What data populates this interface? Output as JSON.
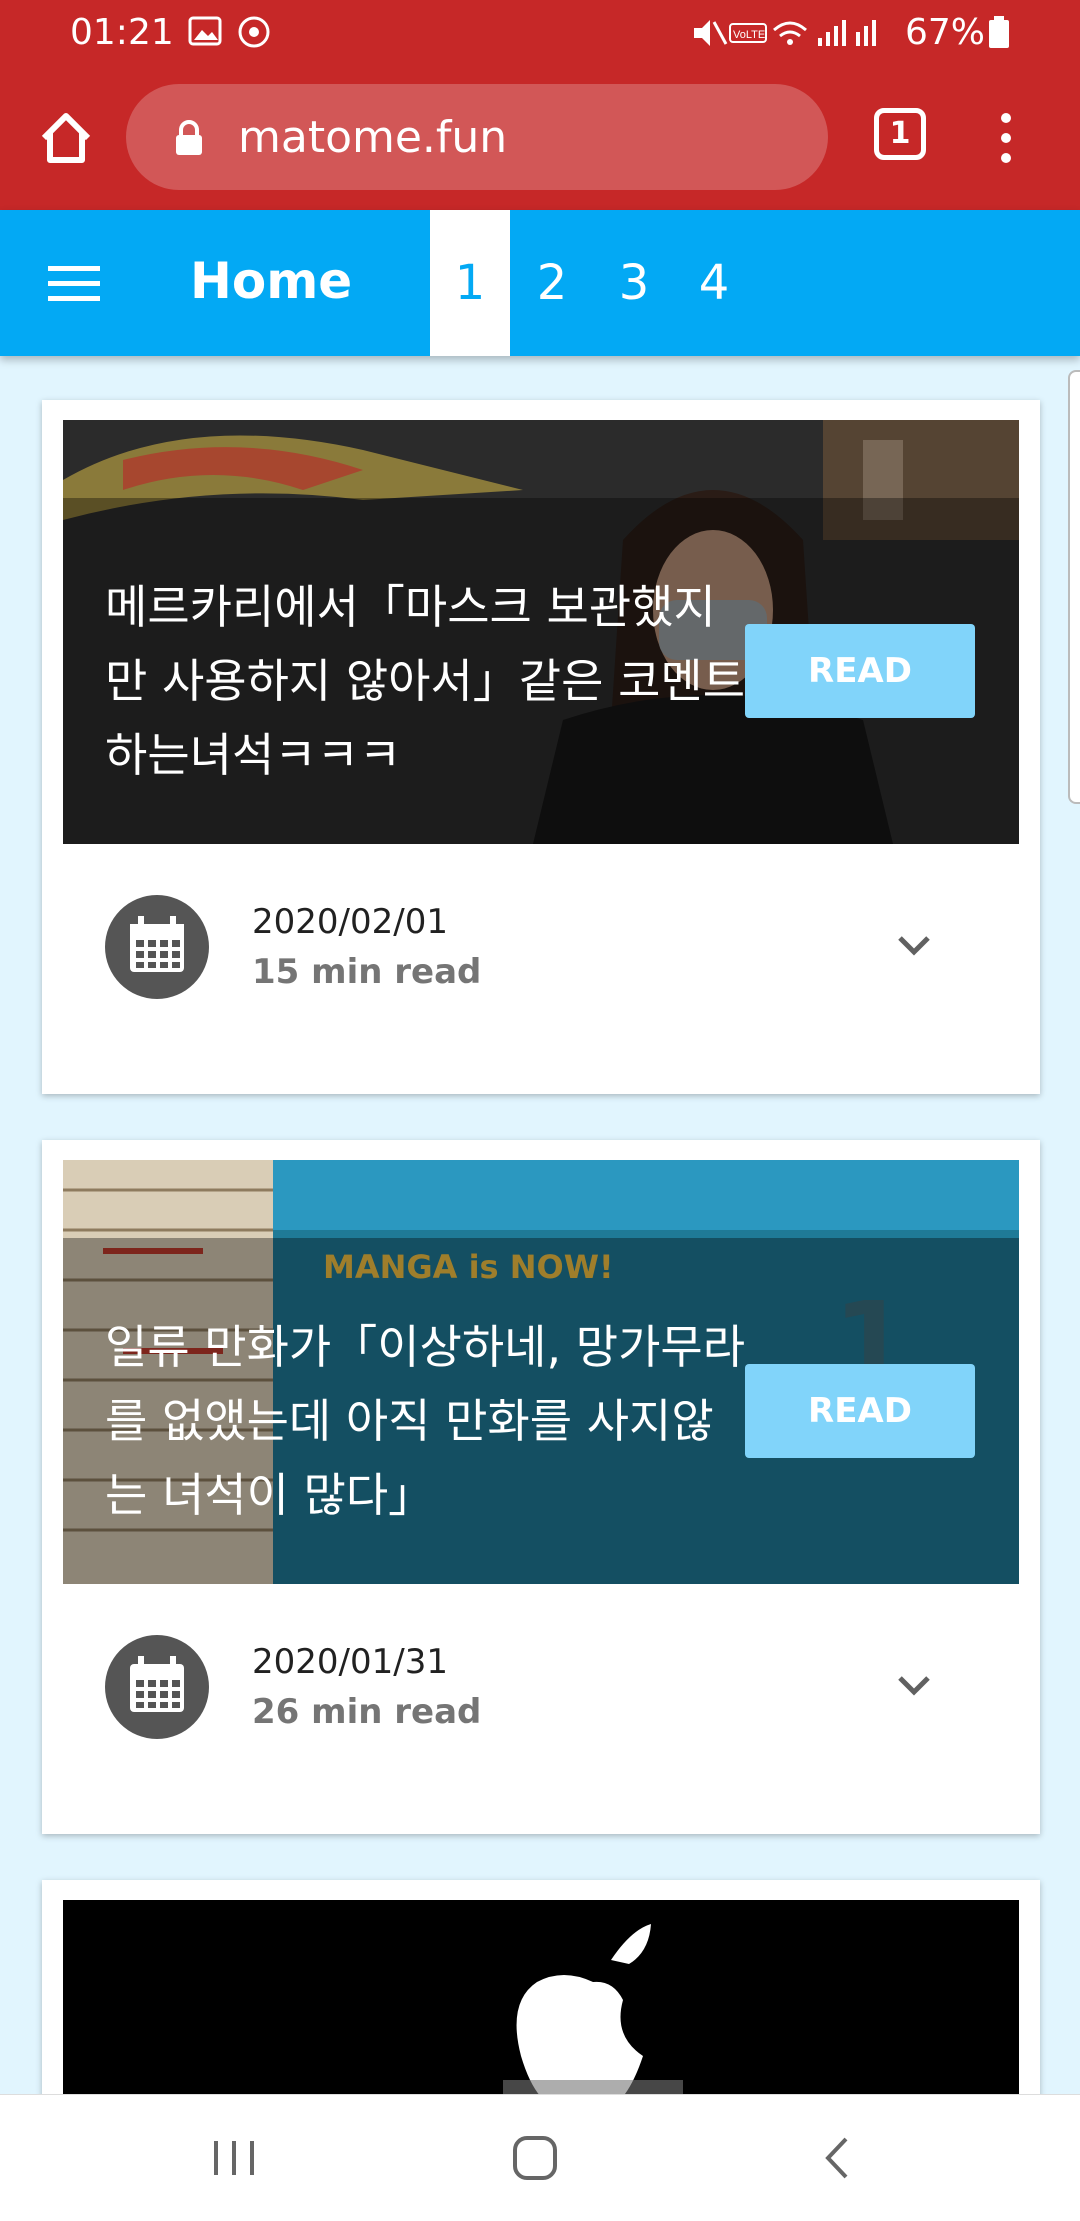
{
  "status_bar": {
    "time": "01:21",
    "battery": "67%"
  },
  "browser": {
    "url": "matome.fun",
    "tab_count": "1"
  },
  "header": {
    "title": "Home",
    "pages": [
      "1",
      "2",
      "3",
      "4"
    ],
    "active_page": "1"
  },
  "articles": [
    {
      "title": "메르카리에서「마스크 보관했지만 사용하지 않아서」같은 코멘트 하는녀석ㅋㅋㅋ",
      "read_label": "READ",
      "date": "2020/02/01",
      "read_time": "15 min read"
    },
    {
      "title": "일류 만화가「이상하네, 망가무라를 없앴는데 아직 만화를 사지않는 녀석이 많다」",
      "read_label": "READ",
      "date": "2020/01/31",
      "read_time": "26 min read"
    }
  ],
  "image_text": {
    "manga_banner": "MANGA is NOW!"
  },
  "colors": {
    "browser_bar": "#c62828",
    "app_bar": "#03a9f4",
    "read_button": "#81d4fa",
    "page_bg": "#e1f5fe"
  }
}
